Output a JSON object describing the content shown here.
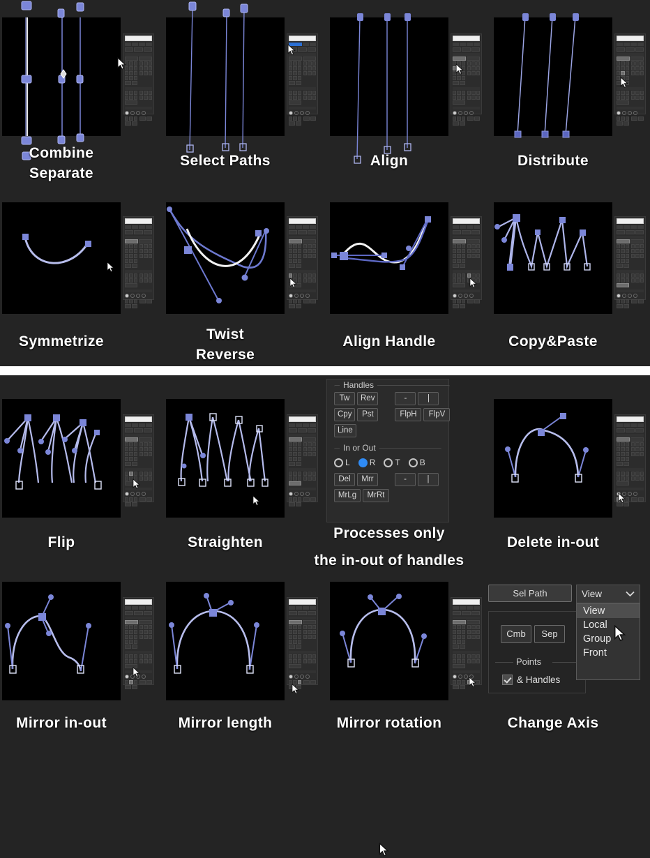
{
  "meta": {
    "app_theme_bg": "#242424",
    "tile_bg": "#000000",
    "accent_blue": "#7b86d8",
    "select_blue": "#2f8bf5",
    "stroke_white": "#f2f2f2",
    "divider_color": "#ffffff"
  },
  "sections": {
    "top": {
      "rows": [
        {
          "tiles": [
            {
              "id": "combine-separate",
              "caption": [
                "Combine",
                "Separate"
              ]
            },
            {
              "id": "select-paths",
              "caption": [
                "Select Paths"
              ]
            },
            {
              "id": "align",
              "caption": [
                "Align"
              ]
            },
            {
              "id": "distribute",
              "caption": [
                "Distribute"
              ]
            }
          ]
        },
        {
          "tiles": [
            {
              "id": "symmetrize",
              "caption": [
                "Symmetrize"
              ]
            },
            {
              "id": "twist-reverse",
              "caption": [
                "Twist",
                "Reverse"
              ]
            },
            {
              "id": "align-handle",
              "caption": [
                "Align Handle"
              ]
            },
            {
              "id": "copy-paste",
              "caption": [
                "Copy&Paste"
              ]
            }
          ]
        }
      ]
    },
    "bottom": {
      "rows": [
        {
          "tiles": [
            {
              "id": "flip",
              "caption": [
                "Flip"
              ]
            },
            {
              "id": "straighten",
              "caption": [
                "Straighten"
              ]
            },
            {
              "id": "handles-panel",
              "caption": [
                "Processes only",
                "the in-out of handles"
              ]
            },
            {
              "id": "delete-in-out",
              "caption": [
                "Delete in-out"
              ]
            }
          ]
        },
        {
          "tiles": [
            {
              "id": "mirror-in-out",
              "caption": [
                "Mirror in-out"
              ]
            },
            {
              "id": "mirror-length",
              "caption": [
                "Mirror length"
              ]
            },
            {
              "id": "mirror-rotation",
              "caption": [
                "Mirror rotation"
              ]
            },
            {
              "id": "change-axis",
              "caption": [
                "Change Axis"
              ]
            }
          ]
        }
      ]
    }
  },
  "handles_panel": {
    "handles_group_label": "Handles",
    "handles_buttons_left": [
      "Tw",
      "Rev",
      "Cpy",
      "Pst",
      "Line"
    ],
    "handles_buttons_right": [
      "-",
      "|",
      "FlpH",
      "FlpV"
    ],
    "btn_tw": "Tw",
    "btn_rev": "Rev",
    "btn_cpy": "Cpy",
    "btn_pst": "Pst",
    "btn_line": "Line",
    "btn_dash": "-",
    "btn_pipe": "|",
    "btn_flph": "FlpH",
    "btn_flpv": "FlpV",
    "inout_group_label": "In or Out",
    "radios": [
      {
        "label": "L",
        "selected": false
      },
      {
        "label": "R",
        "selected": true
      },
      {
        "label": "T",
        "selected": false
      },
      {
        "label": "B",
        "selected": false
      }
    ],
    "btn_del": "Del",
    "btn_mrr": "Mrr",
    "btn_dash2": "-",
    "btn_pipe2": "|",
    "btn_mrlg": "MrLg",
    "btn_mrrt": "MrRt"
  },
  "change_axis_panel": {
    "sel_path_label": "Sel Path",
    "combo_value": "View",
    "combo_options": [
      "View",
      "Local",
      "Group",
      "Front"
    ],
    "combo_selected_index": 0,
    "btn_cmb": "Cmb",
    "btn_sep": "Sep",
    "points_label": "Points",
    "handles_checkbox_label": "& Handles",
    "handles_checkbox_checked": true
  }
}
